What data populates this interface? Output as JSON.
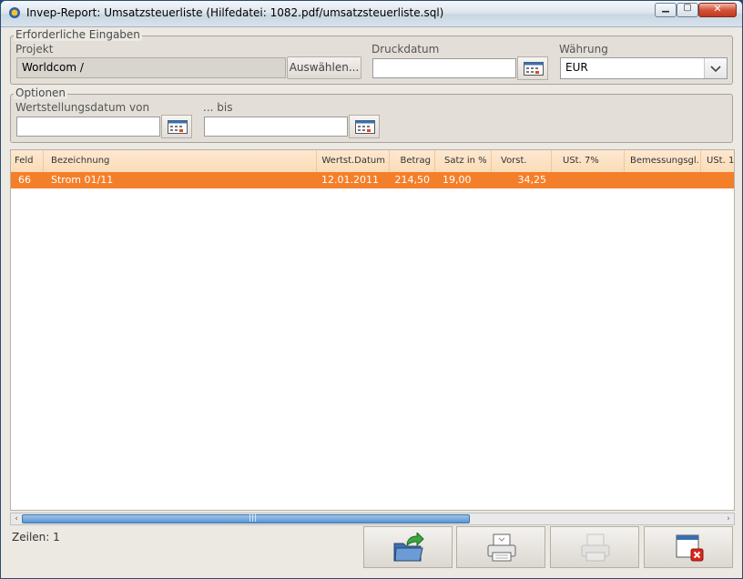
{
  "window": {
    "title": "Invep-Report: Umsatzsteuerliste   (Hilfedatei: 1082.pdf/umsatzsteuerliste.sql)"
  },
  "required": {
    "legend": "Erforderliche Eingaben",
    "project_label": "Projekt",
    "project_value": "Worldcom /",
    "select_button": "Auswählen...",
    "print_date_label": "Druckdatum",
    "print_date_value": "",
    "currency_label": "Währung",
    "currency_value": "EUR"
  },
  "options": {
    "legend": "Optionen",
    "from_label": "Wertstellungsdatum von",
    "from_value": "",
    "to_label": "... bis",
    "to_value": ""
  },
  "table": {
    "columns": [
      "Feld",
      "Bezeichnung",
      "Wertst.Datum",
      "Betrag",
      "Satz in %",
      "Vorst.",
      "USt. 7%",
      "Bemessungsgl.",
      "USt. 1"
    ],
    "rows": [
      {
        "feld": "66",
        "bezeichnung": "Strom 01/11",
        "datum": "12.01.2011",
        "betrag": "214,50",
        "satz": "19,00",
        "vorst": "34,25",
        "ust7": "",
        "bemessung": "",
        "ust": ""
      }
    ]
  },
  "status": {
    "rows_text": "Zeilen: 1"
  },
  "icons": {
    "app": "app-icon",
    "calendar": "calendar-icon",
    "export": "folder-export-icon",
    "print": "printer-icon",
    "print_disabled": "printer-disabled-icon",
    "close": "close-window-icon"
  },
  "colors": {
    "selected_row": "#f47f2a",
    "header_bg": "#fde8cf"
  }
}
